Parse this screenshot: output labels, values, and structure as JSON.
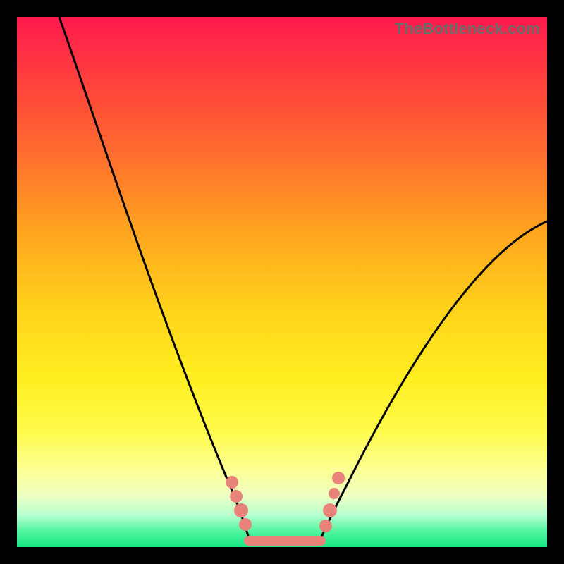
{
  "watermark": "TheBottleneck.com",
  "colors": {
    "background_frame": "#000000",
    "gradient_top": "#ff1a4e",
    "gradient_bottom": "#17e884",
    "curve": "#000000",
    "marker": "#e8837a"
  },
  "chart_data": {
    "type": "line",
    "title": "",
    "xlabel": "",
    "ylabel": "",
    "xlim": [
      0,
      100
    ],
    "ylim": [
      0,
      100
    ],
    "grid": false,
    "legend": false,
    "note": "Axes, ticks, and numeric labels are not displayed in the image; x/y are normalized 0–100. Values are estimated from the rendered geometry. The curve is a V-shape with a flat bottom segment between roughly x≈43 and x≈58 at y≈0; left branch rises steeply to y≈100 near x≈8, right branch rises to y≈62 near x≈100.",
    "series": [
      {
        "name": "bottleneck-curve",
        "x": [
          8,
          12,
          16,
          20,
          24,
          28,
          32,
          36,
          40,
          43,
          50,
          58,
          62,
          66,
          70,
          74,
          78,
          82,
          86,
          90,
          94,
          98,
          100
        ],
        "y": [
          100,
          88,
          76,
          65,
          54,
          44,
          34,
          25,
          16,
          6,
          0,
          6,
          11,
          17,
          23,
          29,
          35,
          41,
          47,
          52,
          57,
          61,
          63
        ]
      }
    ],
    "markers": [
      {
        "name": "left-cluster-top",
        "x": 40,
        "y": 14
      },
      {
        "name": "left-cluster-mid",
        "x": 41,
        "y": 11
      },
      {
        "name": "left-cluster-low",
        "x": 42,
        "y": 8
      },
      {
        "name": "right-cluster-high",
        "x": 60,
        "y": 12
      },
      {
        "name": "right-cluster-mid",
        "x": 59,
        "y": 9
      },
      {
        "name": "right-cluster-low",
        "x": 58,
        "y": 6
      }
    ],
    "flat_segment": {
      "x_start": 43,
      "x_end": 58,
      "y": 0
    }
  }
}
